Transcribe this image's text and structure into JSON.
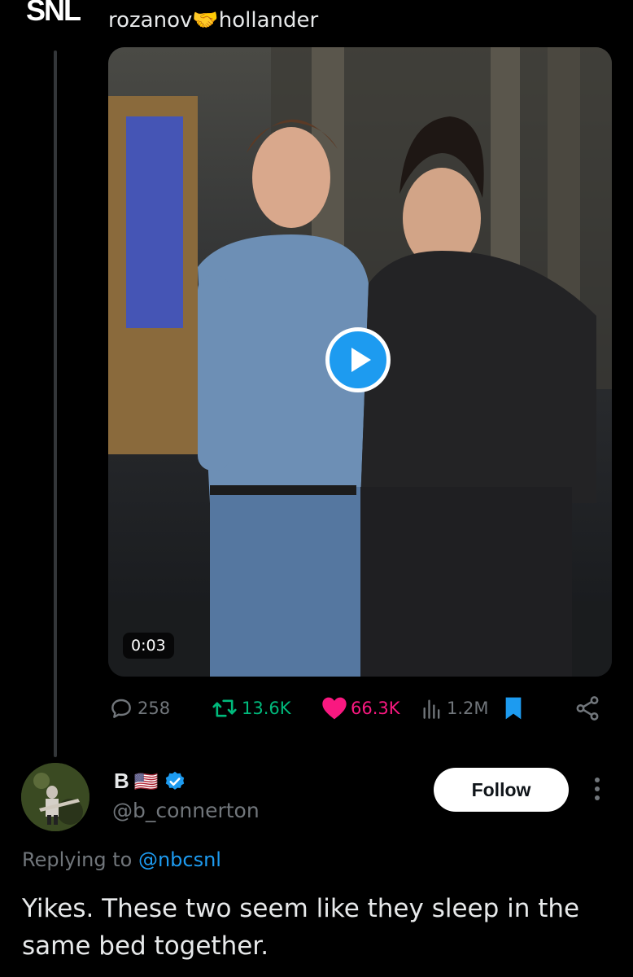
{
  "quoted_tweet": {
    "logo_text": "SNL",
    "text_line": "rozanov🤝hollander",
    "media": {
      "duration": "0:03"
    },
    "actions": {
      "replies": "258",
      "reposts": "13.6K",
      "likes": "66.3K",
      "views": "1.2M"
    }
  },
  "reply": {
    "display_name": "B",
    "flag": "🇺🇸",
    "handle": "@b_connerton",
    "follow_label": "Follow",
    "replying_prefix": "Replying to",
    "replying_to": "@nbcsnl",
    "text": "Yikes. These two seem like they sleep in the same bed together."
  },
  "colors": {
    "accent": "#1d9bf0",
    "repost": "#00ba7c",
    "like": "#f91880",
    "muted": "#71767b"
  },
  "icons": [
    "reply-icon",
    "repost-icon",
    "heart-icon",
    "views-icon",
    "bookmark-icon",
    "share-icon",
    "verified-badge-icon",
    "more-icon",
    "play-icon"
  ]
}
